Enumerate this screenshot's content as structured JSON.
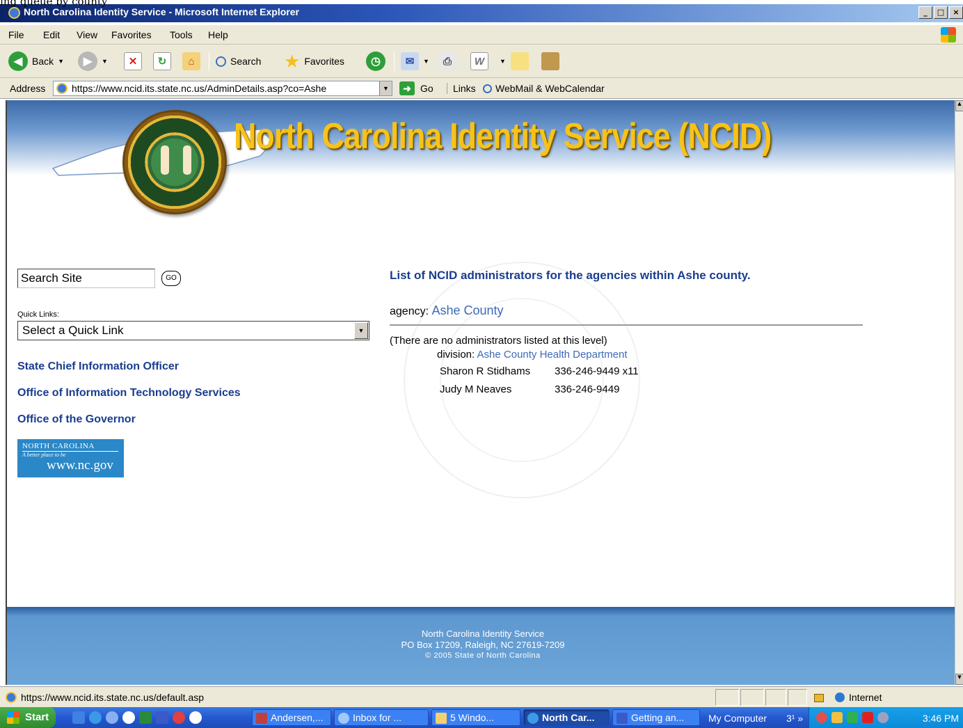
{
  "window": {
    "title": "North Carolina Identity Service - Microsoft Internet Explorer",
    "minimize": "_",
    "maximize": "□",
    "close": "×",
    "overlay_text": "ing queue by county"
  },
  "menu": [
    "File",
    "Edit",
    "View",
    "Favorites",
    "Tools",
    "Help"
  ],
  "toolbar": {
    "back": "Back",
    "search": "Search",
    "favorites": "Favorites"
  },
  "address": {
    "label": "Address",
    "url": "https://www.ncid.its.state.nc.us/AdminDetails.asp?co=Ashe",
    "go": "Go",
    "links": "Links",
    "webmail": "WebMail & WebCalendar"
  },
  "page": {
    "banner_title": "North Carolina Identity Service (NCID)",
    "search_placeholder": "Search Site",
    "search_go": "GO",
    "quick_links_label": "Quick Links:",
    "quick_links_selected": "Select a Quick Link",
    "side_links": [
      "State Chief Information Officer",
      "Office of Information Technology Services",
      "Office of the Governor"
    ],
    "ncgov": {
      "line1": "NORTH CAROLINA",
      "line2": "A better place to be",
      "line3": "www.nc.gov"
    },
    "heading": "List of NCID administrators for the agencies within Ashe county.",
    "agency_label": "agency:",
    "agency_value": "Ashe County",
    "no_admins_note": "(There are no administrators listed at this level)",
    "division_label": "division:",
    "division_value": "Ashe County Health Department",
    "administrators": [
      {
        "name": "Sharon R Stidhams",
        "phone": "336-246-9449 x11"
      },
      {
        "name": "Judy M Neaves",
        "phone": "336-246-9449"
      }
    ],
    "footer": {
      "line1": "North Carolina Identity Service",
      "line2": "PO Box 17209, Raleigh, NC 27619-7209",
      "line3": "© 2005 State of North Carolina"
    }
  },
  "status": {
    "url": "https://www.ncid.its.state.nc.us/default.asp",
    "zone": "Internet"
  },
  "taskbar": {
    "start": "Start",
    "tasks": [
      "Andersen,...",
      "Inbox for ...",
      "5 Windo...",
      "North Car...",
      "Getting an..."
    ],
    "my_computer": "My Computer",
    "tray_text": "3¹ »",
    "clock": "3:46 PM"
  },
  "colors": {
    "link_blue": "#1a3d8f",
    "value_blue": "#3b6ab8",
    "banner_gold": "#f7c31a",
    "footer_blue": "#6ea6d8"
  }
}
